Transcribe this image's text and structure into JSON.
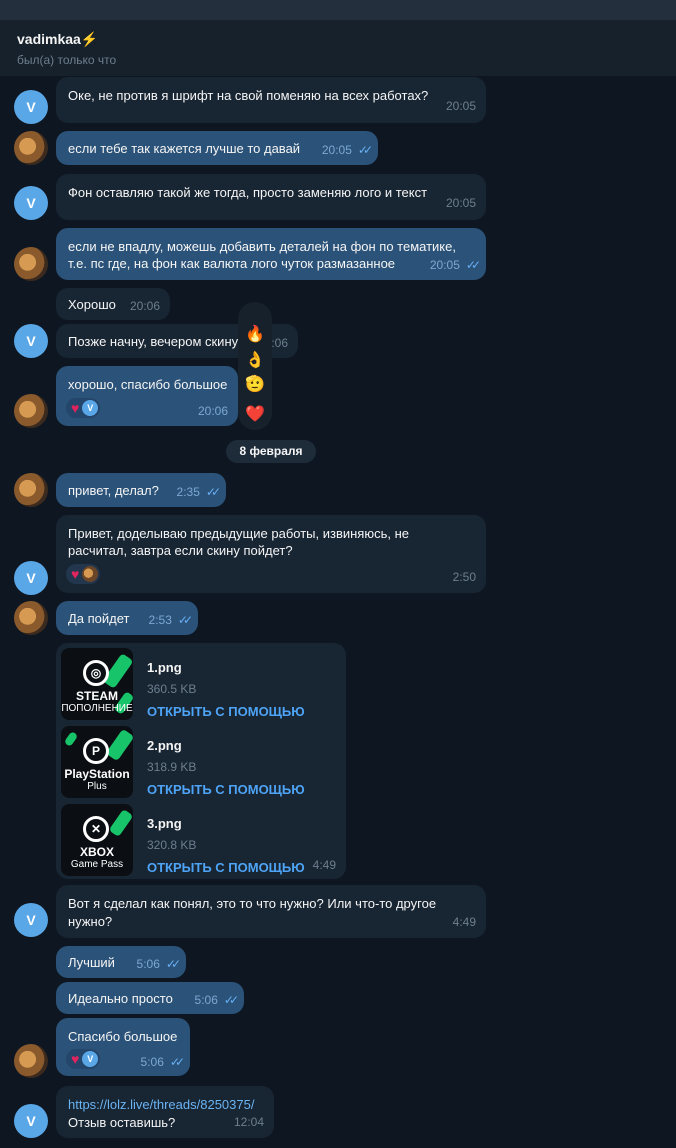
{
  "header": {
    "name": "vadimkaa⚡",
    "status": "был(а) только что"
  },
  "avatars": {
    "contact_letter": "V"
  },
  "messages": {
    "m1": {
      "text": "Оке, не против я шрифт на свой поменяю на всех работах?",
      "time": "20:05"
    },
    "m2": {
      "text": "если тебе так кажется лучше то давай",
      "time": "20:05"
    },
    "m3": {
      "text": "Фон оставляю такой же тогда, просто заменяю лого и текст",
      "time": "20:05"
    },
    "m4": {
      "line1": "если не впадлу, можешь добавить деталей на фон по тематике,",
      "line2": "т.е. пс где, на фон как валюта лого чуток размазанное",
      "time": "20:05"
    },
    "m5": {
      "text": "Хорошо",
      "time": "20:06"
    },
    "m6": {
      "text": "Позже начну, вечером скину",
      "time": "20:06"
    },
    "m7": {
      "text": "хорошо, спасибо большое",
      "time": "20:06",
      "react_letter": "V"
    },
    "date": "8 февраля",
    "m8": {
      "text": "привет, делал?",
      "time": "2:35"
    },
    "m9": {
      "line1": "Привет, доделываю предыдущие работы, извиняюсь, не",
      "line2": "расчитал, завтра если скину пойдет?",
      "time": "2:50"
    },
    "m10": {
      "text": "Да пойдет",
      "time": "2:53"
    },
    "files": {
      "items": [
        {
          "name": "1.png",
          "size": "360.5 KB",
          "open": "ОТКРЫТЬ С ПОМОЩЬЮ",
          "brand": "STEAM",
          "sub": "ПОПОЛНЕНИЕ"
        },
        {
          "name": "2.png",
          "size": "318.9 KB",
          "open": "ОТКРЫТЬ С ПОМОЩЬЮ",
          "brand": "PlayStation",
          "sub": "Plus"
        },
        {
          "name": "3.png",
          "size": "320.8 KB",
          "open": "ОТКРЫТЬ С ПОМОЩЬЮ",
          "brand": "XBOX",
          "sub": "Game Pass"
        }
      ],
      "time": "4:49"
    },
    "m11": {
      "line1": "Вот я сделал как понял, это то что нужно? Или что-то другое",
      "line2": "нужно?",
      "time": "4:49"
    },
    "m12": {
      "text": "Лучший",
      "time": "5:06"
    },
    "m13": {
      "text": "Идеально просто",
      "time": "5:06"
    },
    "m14": {
      "text": "Спасибо большое",
      "time": "5:06",
      "react_letter": "V"
    },
    "m15": {
      "link": "https://lolz.live/threads/8250375/",
      "text": "Отзыв оставишь?",
      "time": "12:04"
    }
  },
  "reaction_picker": {
    "emojis": [
      "🔥",
      "👌",
      "🫡",
      "❤️"
    ]
  },
  "colors": {
    "background": "#0e1621",
    "incoming": "#182533",
    "outgoing": "#2b5278",
    "accent": "#6ab3f3"
  }
}
